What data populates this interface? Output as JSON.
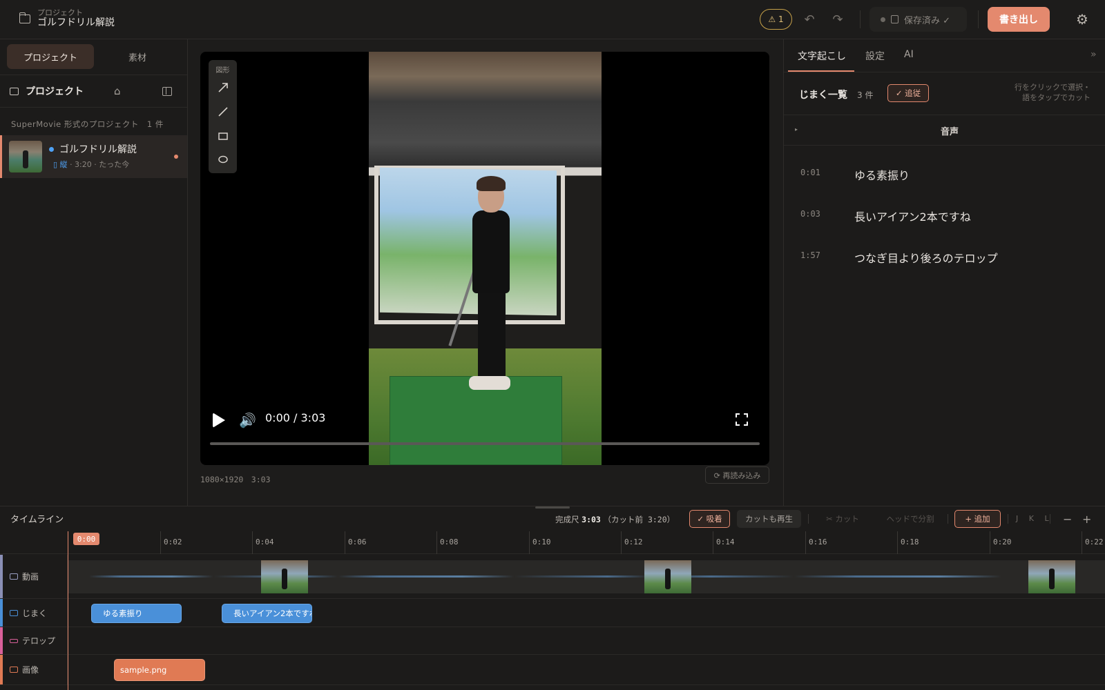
{
  "header": {
    "crumb_label": "プロジェクト",
    "project_title": "ゴルフドリル解説",
    "warning_count": "⚠ 1",
    "save_state": "保存済み ✓",
    "export_label": "書き出し"
  },
  "sidebar": {
    "tabs": [
      "プロジェクト",
      "素材"
    ],
    "header_title": "プロジェクト",
    "section_label": "SuperMovie 形式のプロジェクト　1 件",
    "project": {
      "name": "ゴルフドリル解説",
      "orientation": "▯ 縦",
      "meta": "· 3:20 · たった今"
    }
  },
  "preview": {
    "shapes_label": "図形",
    "time_display": "0:00 / 3:03",
    "dims": "1080×1920　3:03",
    "reload_label": "⟳ 再読み込み",
    "progress": 0.0
  },
  "right_panel": {
    "tabs": [
      "文字起こし",
      "設定",
      "AI"
    ],
    "expand": "»",
    "subtitle_list_title": "じまく一覧",
    "subtitle_count": "3 件",
    "follow_label": "✓ 追従",
    "hint_line1": "行をクリックで選択・",
    "hint_line2": "語をタップでカット",
    "audio_label": "音声",
    "items": [
      {
        "time": "0:01",
        "text": "ゆる素振り"
      },
      {
        "time": "0:03",
        "text": "長いアイアン2本ですね"
      },
      {
        "time": "1:57",
        "text": "つなぎ目より後ろのテロップ"
      }
    ]
  },
  "timeline": {
    "title": "タイムライン",
    "final_label": "完成尺",
    "final_value": "3:03",
    "precut": "（カット前 3:20）",
    "snap_label": "✓ 吸着",
    "play_cut_label": "カットも再生",
    "cut_label": "✂ カット",
    "split_label": "ヘッドで分割",
    "add_label": "+ 追加",
    "jkl": "J K L",
    "zoom_out": "−",
    "zoom_in": "+",
    "playhead": "0:00",
    "ticks": [
      "0:02",
      "0:04",
      "0:06",
      "0:08",
      "0:10",
      "0:12",
      "0:14",
      "0:16",
      "0:18",
      "0:20",
      "0:22"
    ],
    "tracks": {
      "video": "動画",
      "subtitle": "じまく",
      "telop": "テロップ",
      "image": "画像"
    },
    "clips": {
      "sub1": "ゆる素振り",
      "sub2": "長いアイアン2本ですね",
      "img1": "sample.png"
    }
  },
  "colors": {
    "accent": "#e4896e",
    "video_track": "#8a8fb5",
    "subtitle_track": "#4a90d9",
    "telop_track": "#d9609a",
    "image_track": "#e07a54"
  }
}
